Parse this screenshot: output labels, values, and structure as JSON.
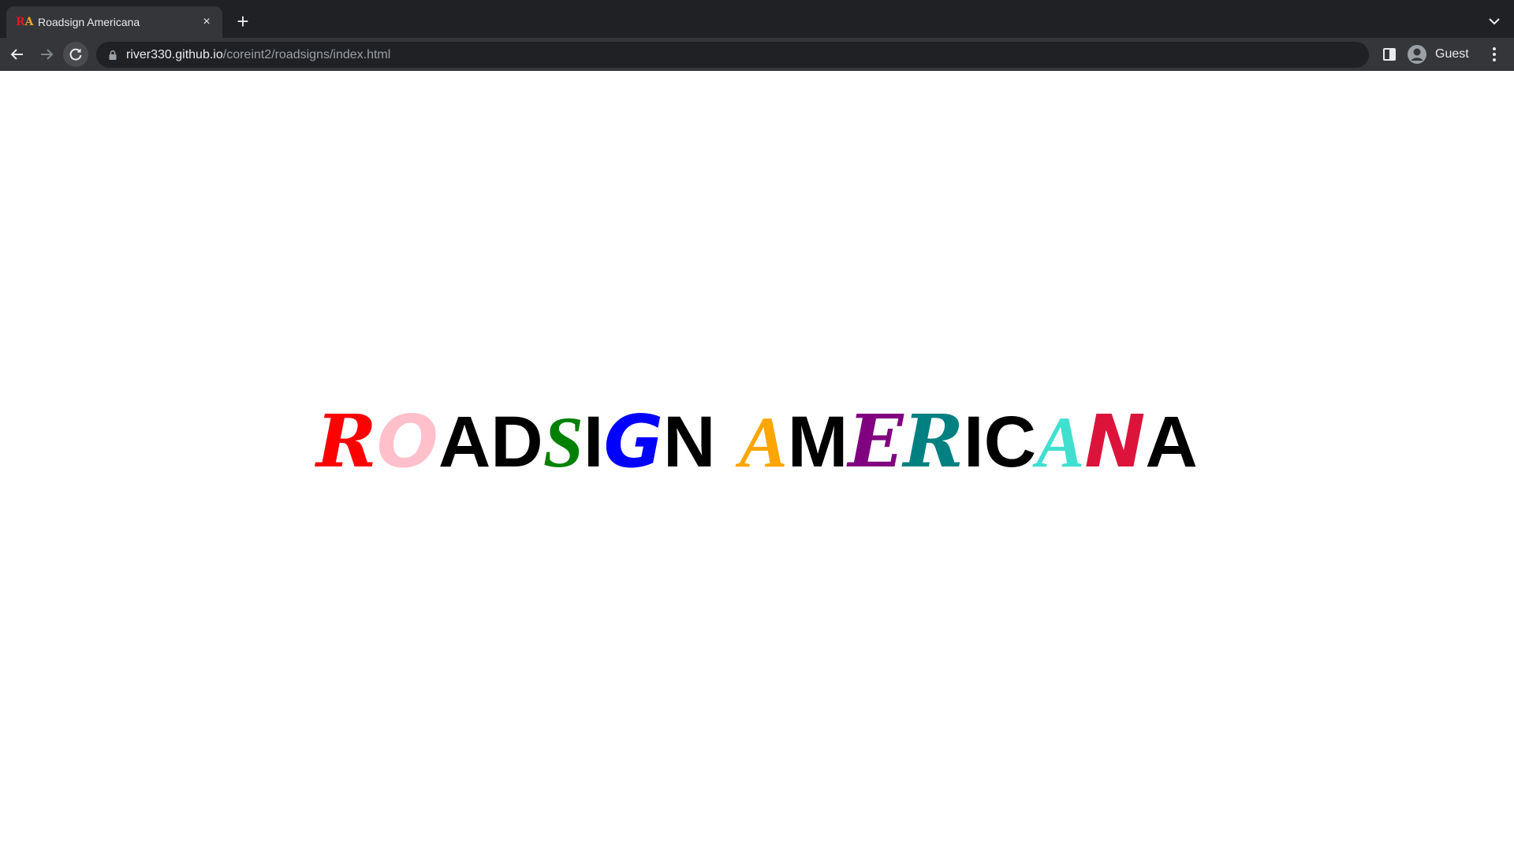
{
  "browser": {
    "tab": {
      "favicon_text": "R",
      "favicon_text2": "A",
      "title": "Roadsign Americana",
      "close_glyph": "×"
    },
    "new_tab_glyph": "+",
    "omnibox": {
      "host": "river330.github.io",
      "path": "/coreint2/roadsigns/index.html"
    },
    "profile": {
      "name": "Guest"
    }
  },
  "page": {
    "title_letters": [
      {
        "char": "R",
        "color": "#ff0000",
        "style": "fancy-a"
      },
      {
        "char": "O",
        "color": "#ffc0cb",
        "style": "fancy-b"
      },
      {
        "char": "A",
        "color": "#000000",
        "style": "plain"
      },
      {
        "char": "D",
        "color": "#000000",
        "style": "plain"
      },
      {
        "char": "S",
        "color": "#008000",
        "style": "fancy-c"
      },
      {
        "char": "I",
        "color": "#000000",
        "style": "plain"
      },
      {
        "char": "G",
        "color": "#0000ff",
        "style": "fancy-b"
      },
      {
        "char": "N",
        "color": "#000000",
        "style": "plain"
      },
      {
        "char": " ",
        "color": "#000000",
        "style": "space"
      },
      {
        "char": "A",
        "color": "#ffa500",
        "style": "fancy-c"
      },
      {
        "char": "M",
        "color": "#000000",
        "style": "plain"
      },
      {
        "char": "E",
        "color": "#800080",
        "style": "fancy-a"
      },
      {
        "char": "R",
        "color": "#008080",
        "style": "fancy-a"
      },
      {
        "char": "I",
        "color": "#000000",
        "style": "plain"
      },
      {
        "char": "C",
        "color": "#000000",
        "style": "plain"
      },
      {
        "char": "A",
        "color": "#40e0d0",
        "style": "fancy-c"
      },
      {
        "char": "N",
        "color": "#dc143c",
        "style": "fancy-b"
      },
      {
        "char": "A",
        "color": "#000000",
        "style": "plain"
      }
    ]
  }
}
